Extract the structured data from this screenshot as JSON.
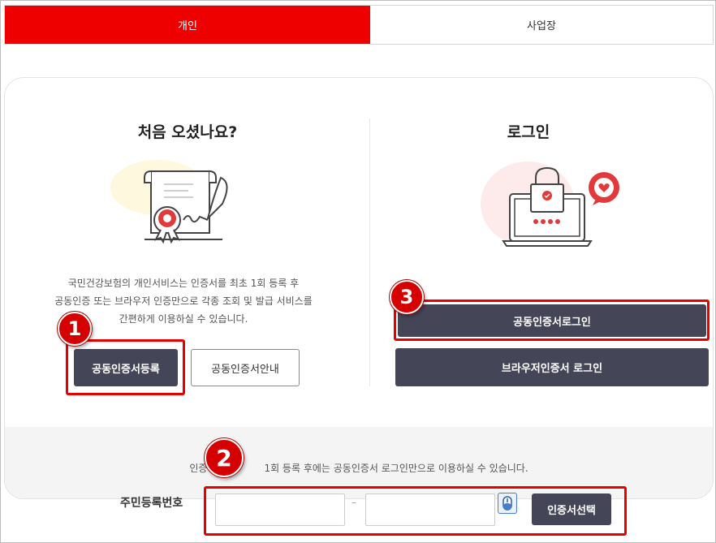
{
  "tabs": [
    {
      "label": "개인",
      "active": true
    },
    {
      "label": "사업장",
      "active": false
    }
  ],
  "first_visit": {
    "title": "처음 오셨나요?",
    "description": "국민건강보험의 개인서비스는 인증서를 최초 1회 등록 후\n공동인증 또는 브라우저 인증만으로 각종 조회 및 발급 서비스를\n간편하게 이용하실 수 있습니다.",
    "register_button": "공동인증서등록",
    "guide_button": "공동인증서안내",
    "illustration_icon": "certificate-quill-icon"
  },
  "login": {
    "title": "로그인",
    "cert_login_button": "공동인증서로그인",
    "browser_login_button": "브라우저인증서 로그인",
    "illustration_icon": "laptop-lock-icon"
  },
  "registration": {
    "notice_prefix": "인증",
    "notice_suffix": "1회 등록 후에는 공동인증서 로그인만으로 이용하실 수 있습니다.",
    "rrn_label": "주민등록번호",
    "rrn_first_value": "",
    "rrn_second_value": "",
    "dash": "–",
    "select_cert_button": "인증서선택"
  },
  "annotations": {
    "badge_1": "1",
    "badge_2": "2",
    "badge_3": "3",
    "highlight_color": "#e60000"
  },
  "colors": {
    "accent": "#ee0000",
    "button_dark": "#454558"
  }
}
